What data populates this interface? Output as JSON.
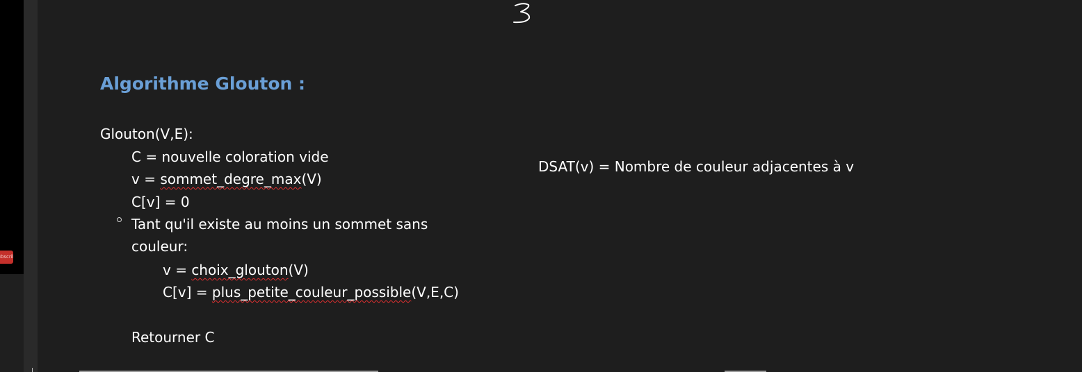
{
  "sidebar": {
    "subscribe_label": "Subscribe"
  },
  "heading": "Algorithme Glouton :",
  "code": {
    "signature": "Glouton(V,E):",
    "line1": "C = nouvelle coloration vide",
    "line2_prefix": "v = ",
    "line2_func": "sommet_degre_max",
    "line2_suffix": "(V)",
    "line3": "C[v] = 0",
    "loop_line1": "Tant qu'il existe au moins un sommet sans",
    "loop_line2": "couleur:",
    "inner1_prefix": "v = ",
    "inner1_func": "choix_glouton",
    "inner1_suffix": "(V)",
    "inner2_prefix": "C[v] = ",
    "inner2_func": "plus_petite_couleur_possible",
    "inner2_suffix": "(V,E,C)",
    "return_line": "Retourner C"
  },
  "definition": "DSAT(v) = Nombre de couleur adjacentes à v",
  "colors": {
    "heading": "#6a9fd6",
    "text": "#ffffff",
    "background": "#1e1e1e",
    "spellcheck": "#e03030",
    "subscribe": "#c4302b"
  }
}
